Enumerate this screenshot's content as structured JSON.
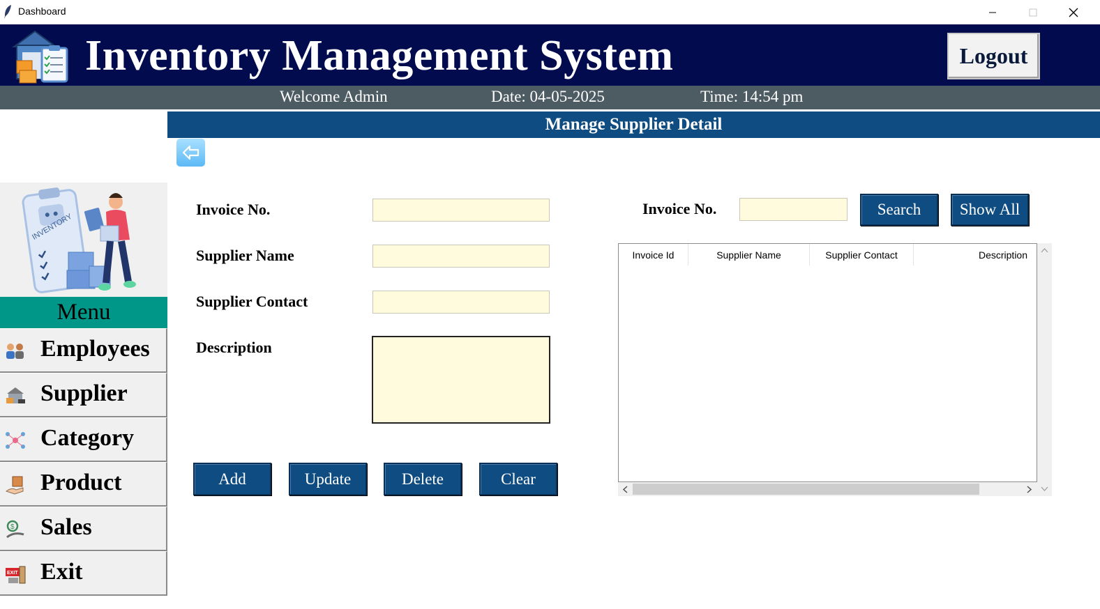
{
  "window": {
    "title": "Dashboard"
  },
  "header": {
    "app_title": "Inventory Management System",
    "logout_label": "Logout"
  },
  "subheader": {
    "welcome": "Welcome Admin",
    "date": "Date: 04-05-2025",
    "time": "Time: 14:54 pm"
  },
  "page": {
    "title": "Manage Supplier Detail"
  },
  "sidebar": {
    "menu_label": "Menu",
    "items": [
      {
        "label": "Employees",
        "icon": "employees-icon"
      },
      {
        "label": "Supplier",
        "icon": "supplier-icon"
      },
      {
        "label": "Category",
        "icon": "category-icon"
      },
      {
        "label": "Product",
        "icon": "product-icon"
      },
      {
        "label": "Sales",
        "icon": "sales-icon"
      },
      {
        "label": "Exit",
        "icon": "exit-icon"
      }
    ]
  },
  "form": {
    "invoice_label": "Invoice No.",
    "invoice_value": "",
    "supplier_name_label": "Supplier Name",
    "supplier_name_value": "",
    "supplier_contact_label": "Supplier Contact",
    "supplier_contact_value": "",
    "description_label": "Description",
    "description_value": ""
  },
  "actions": {
    "add": "Add",
    "update": "Update",
    "delete": "Delete",
    "clear": "Clear"
  },
  "search": {
    "label": "Invoice No.",
    "value": "",
    "search_button": "Search",
    "show_all_button": "Show All"
  },
  "table": {
    "columns": [
      "Invoice Id",
      "Supplier Name",
      "Supplier Contact",
      "Description"
    ],
    "rows": []
  },
  "colors": {
    "header_bg": "#010b4d",
    "subheader_bg": "#4d5b63",
    "accent_blue": "#0f4c81",
    "menu_teal": "#009688",
    "input_bg": "#fffbdc"
  }
}
